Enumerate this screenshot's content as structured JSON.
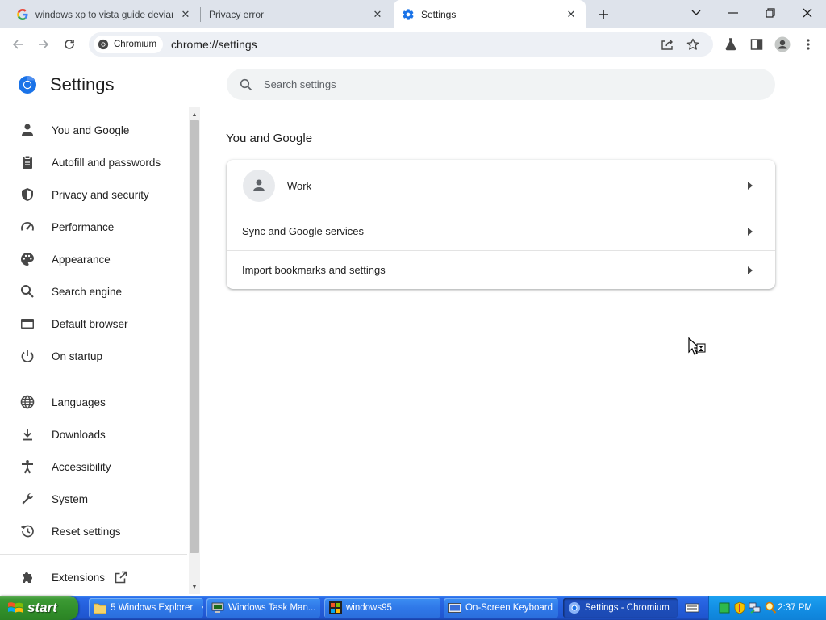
{
  "browser": {
    "tabs": [
      {
        "title": "windows xp to vista guide devianta",
        "favicon": "google-g-icon",
        "active": false
      },
      {
        "title": "Privacy error",
        "favicon": "none",
        "active": false
      },
      {
        "title": "Settings",
        "favicon": "gear-icon",
        "active": true
      }
    ],
    "security_chip": "Chromium",
    "url": "chrome://settings"
  },
  "settings": {
    "title": "Settings",
    "search_placeholder": "Search settings",
    "nav_items": [
      {
        "label": "You and Google",
        "icon": "person-icon"
      },
      {
        "label": "Autofill and passwords",
        "icon": "clipboard-icon"
      },
      {
        "label": "Privacy and security",
        "icon": "shield-icon"
      },
      {
        "label": "Performance",
        "icon": "speedometer-icon"
      },
      {
        "label": "Appearance",
        "icon": "palette-icon"
      },
      {
        "label": "Search engine",
        "icon": "search-icon"
      },
      {
        "label": "Default browser",
        "icon": "browser-window-icon"
      },
      {
        "label": "On startup",
        "icon": "power-icon"
      },
      {
        "label": "Languages",
        "icon": "globe-icon"
      },
      {
        "label": "Downloads",
        "icon": "download-icon"
      },
      {
        "label": "Accessibility",
        "icon": "accessibility-icon"
      },
      {
        "label": "System",
        "icon": "wrench-icon"
      },
      {
        "label": "Reset settings",
        "icon": "history-icon"
      },
      {
        "label": "Extensions",
        "icon": "puzzle-icon"
      }
    ],
    "section_title": "You and Google",
    "card_rows": [
      {
        "label": "Work"
      },
      {
        "label": "Sync and Google services"
      },
      {
        "label": "Import bookmarks and settings"
      }
    ]
  },
  "taskbar": {
    "start_label": "start",
    "tasks": [
      {
        "label": "5 Windows Explorer",
        "icon": "folder-icon",
        "active": false
      },
      {
        "label": "Windows Task Man...",
        "icon": "task-manager-icon",
        "active": false
      },
      {
        "label": "windows95",
        "icon": "windows-logo-icon",
        "active": false
      },
      {
        "label": "On-Screen Keyboard",
        "icon": "keyboard-icon",
        "active": false
      },
      {
        "label": "Settings - Chromium",
        "icon": "chromium-icon",
        "active": true
      }
    ],
    "clock": "2:37 PM"
  },
  "colors": {
    "tab_strip_bg": "#dee3eb",
    "chromium_blue": "#1a73e8",
    "xp_taskbar_blue": "#245edb",
    "xp_start_green": "#318e2a"
  }
}
